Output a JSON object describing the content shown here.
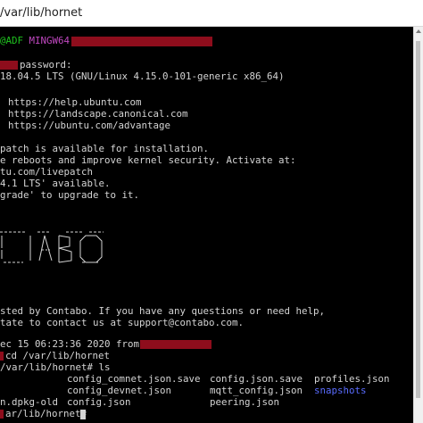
{
  "window": {
    "title": "/var/lib/hornet"
  },
  "colors": {
    "background": "#000000",
    "text": "#d4d4d4",
    "prompt_user": "#1fc41f",
    "prompt_env": "#c148c1",
    "directory": "#5a6cff",
    "redaction": "#8e0d1c"
  },
  "terminal": {
    "prompt_host_fragment": "@ADF",
    "prompt_env": "MINGW64",
    "password_line": "password:",
    "welcome_line": "18.04.5 LTS (GNU/Linux 4.15.0-101-generic x86_64)",
    "links": [
      "https://help.ubuntu.com",
      "https://landscape.canonical.com",
      "https://ubuntu.com/advantage"
    ],
    "livepatch": [
      "patch is available for installation.",
      "e reboots and improve kernel security. Activate at:",
      "tu.com/livepatch",
      "4.1 LTS' available.",
      "grade' to upgrade to it."
    ],
    "ascii_art": [
      "___  ____  _    ____   ___",
      "  |  | __ \\|__)/ _ \\",
      " |___ |__/ |  \\|__/\\___/"
    ],
    "hosted_lines": [
      "sted by Contabo. If you have any questions or need help,",
      "tate to contact us at support@contabo.com."
    ],
    "last_login": "ec 15 06:23:36 2020 from",
    "cd_line": "cd /var/lib/hornet",
    "ls_line": "/var/lib/hornet# ls",
    "ls_rows": [
      {
        "c1": "",
        "c2": "config_comnet.json.save",
        "c3": "config.json.save",
        "c4": "profiles.json"
      },
      {
        "c1": "",
        "c2": "config_devnet.json",
        "c3": "mqtt_config.json",
        "c4": "snapshots"
      },
      {
        "c1": "n.dpkg-old",
        "c2": "config.json",
        "c3": "peering.json",
        "c4": ""
      }
    ],
    "final_prompt": "ar/lib/hornet#"
  }
}
